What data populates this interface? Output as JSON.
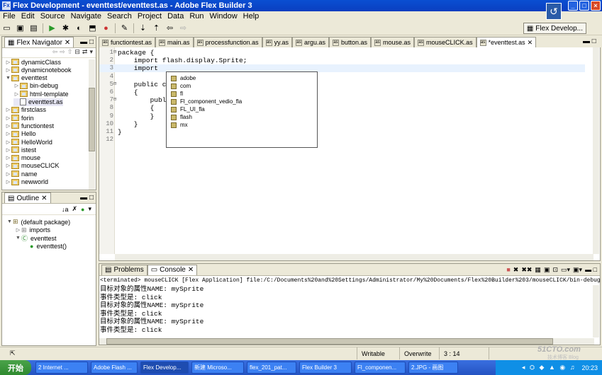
{
  "window": {
    "title": "Flex Development - eventtest/eventtest.as - Adobe Flex Builder 3",
    "app_icon": "Fx"
  },
  "menu": [
    "File",
    "Edit",
    "Source",
    "Navigate",
    "Search",
    "Project",
    "Data",
    "Run",
    "Window",
    "Help"
  ],
  "perspective": {
    "label": "Flex Develop..."
  },
  "navigator": {
    "title": "Flex Navigator",
    "items": [
      {
        "label": "dynamicClass",
        "depth": 0,
        "expanded": false
      },
      {
        "label": "dynamicnotebook",
        "depth": 0,
        "expanded": false
      },
      {
        "label": "eventtest",
        "depth": 0,
        "expanded": true
      },
      {
        "label": "bin-debug",
        "depth": 1,
        "expanded": false
      },
      {
        "label": "html-template",
        "depth": 1,
        "expanded": false
      },
      {
        "label": "eventtest.as",
        "depth": 1,
        "file": true
      },
      {
        "label": "firstclass",
        "depth": 0,
        "expanded": false
      },
      {
        "label": "forin",
        "depth": 0,
        "expanded": false
      },
      {
        "label": "functiontest",
        "depth": 0,
        "expanded": false
      },
      {
        "label": "Hello",
        "depth": 0,
        "expanded": false
      },
      {
        "label": "HelloWorld",
        "depth": 0,
        "expanded": false
      },
      {
        "label": "istest",
        "depth": 0,
        "expanded": false
      },
      {
        "label": "mouse",
        "depth": 0,
        "expanded": false
      },
      {
        "label": "mouseCLICK",
        "depth": 0,
        "expanded": false
      },
      {
        "label": "name",
        "depth": 0,
        "expanded": false
      },
      {
        "label": "newworld",
        "depth": 0,
        "expanded": false
      }
    ]
  },
  "outline": {
    "title": "Outline",
    "items": [
      {
        "label": "(default package)",
        "depth": 0
      },
      {
        "label": "imports",
        "depth": 1
      },
      {
        "label": "eventtest",
        "depth": 1
      },
      {
        "label": "eventtest()",
        "depth": 2
      }
    ]
  },
  "editor": {
    "tabs": [
      "functiontest.as",
      "main.as",
      "processfunction.as",
      "yy.as",
      "argu.as",
      "button.as",
      "mouse.as",
      "mouseCLICK.as",
      "*eventtest.as"
    ],
    "active_tab": "*eventtest.as",
    "lines": [
      {
        "n": "1",
        "text": "package {",
        "fold": true
      },
      {
        "n": "2",
        "text": "    import flash.display.Sprite;"
      },
      {
        "n": "3",
        "text": "    import ",
        "current": true
      },
      {
        "n": "4",
        "text": ""
      },
      {
        "n": "5",
        "text": "    public cl",
        "fold": true
      },
      {
        "n": "6",
        "text": "    {"
      },
      {
        "n": "7",
        "text": "        publi",
        "fold": true
      },
      {
        "n": "8",
        "text": "        {"
      },
      {
        "n": "9",
        "text": "        }"
      },
      {
        "n": "10",
        "text": "    }"
      },
      {
        "n": "11",
        "text": "}"
      },
      {
        "n": "12",
        "text": ""
      }
    ],
    "autocomplete": [
      "adobe",
      "com",
      "fl",
      "Fl_component_vedio_fla",
      "FL_UI_fla",
      "flash",
      "mx"
    ]
  },
  "console": {
    "tabs": [
      "Problems",
      "Console"
    ],
    "active_tab": "Console",
    "header": "<terminated> mouseCLICK [Flex Application] file:/C:/Documents%20and%20Settings/Administrator/My%20Documents/Flex%20Builder%203/mouseCLICK/bin-debug/mouseCLICK.html",
    "lines": [
      "目标对象的属性NAME: mySprite",
      "事件类型是: click",
      "目标对象的属性NAME: mySprite",
      "事件类型是: click",
      "目标对象的属性NAME: mySprite",
      "事件类型是: click"
    ]
  },
  "status": {
    "mode": "Writable",
    "insert": "Overwrite",
    "position": "3 : 14"
  },
  "taskbar": {
    "start": "开始",
    "tasks": [
      "2 Internet ...",
      "Adobe Flash ...",
      "Flex Develop...",
      "新建 Microso...",
      "flex_201_pat...",
      "Flex Builder 3",
      "Fl_componen...",
      "2.JPG - 画图"
    ],
    "active_task": "Flex Develop...",
    "clock": "20:23"
  },
  "watermark": {
    "text": "51CTO.com",
    "sub": "技术博客 Blog"
  }
}
